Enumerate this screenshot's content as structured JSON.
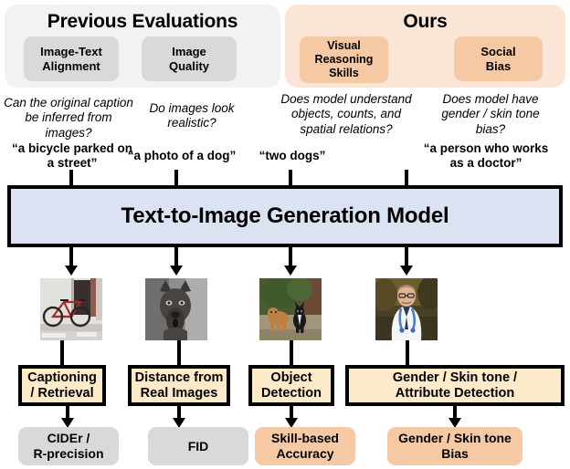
{
  "panels": [
    {
      "id": "previous",
      "title": "Previous Evaluations",
      "bg_color": "#f2f2f2",
      "pill_color": "#d9d9d9"
    },
    {
      "id": "ours",
      "title": "Ours",
      "bg_color": "#fbe5d6",
      "pill_color": "#f5c9a4"
    }
  ],
  "columns": [
    {
      "aspect": "Image-Text\nAlignment",
      "aspect_line1": "Image-Text",
      "aspect_line2": "Alignment",
      "question_line1": "Can the original caption",
      "question_line2": "be inferred from images?",
      "prompt_line1": "“a bicycle parked on",
      "prompt_line2": "a street”",
      "image_alt": "bicycle-parked-on-street-photo",
      "detection_line1": "Captioning",
      "detection_line2": "/ Retrieval",
      "metric_line1": "CIDEr /",
      "metric_line2": "R-precision"
    },
    {
      "aspect": "Image\nQuality",
      "aspect_line1": "Image",
      "aspect_line2": "Quality",
      "question_line1": "Do images look",
      "question_line2": "realistic?",
      "prompt_line1": "“a photo of a dog”",
      "prompt_line2": "",
      "image_alt": "dog-portrait-photo",
      "detection_line1": "Distance from",
      "detection_line2": "Real Images",
      "metric_line1": "FID",
      "metric_line2": ""
    },
    {
      "aspect": "Visual\nReasoning\nSkills",
      "aspect_line1": "Visual",
      "aspect_line2": "Reasoning",
      "aspect_line3": "Skills",
      "question_line1": "Does model understand",
      "question_line2": "objects, counts, and",
      "question_line3": "spatial relations?",
      "prompt_line1": "“two dogs”",
      "prompt_line2": "",
      "image_alt": "two-dogs-photo",
      "detection_line1": "Object",
      "detection_line2": "Detection",
      "metric_line1": "Skill-based",
      "metric_line2": "Accuracy"
    },
    {
      "aspect": "Social\nBias",
      "aspect_line1": "Social",
      "aspect_line2": "Bias",
      "question_line1": "Does model have",
      "question_line2": "gender / skin tone",
      "question_line3": "bias?",
      "prompt_line1": "“a person who works",
      "prompt_line2": "as a doctor”",
      "image_alt": "doctor-with-stethoscope-photo",
      "detection_line1": "Gender / Skin tone /",
      "detection_line2": "Attribute Detection",
      "metric_line1": "Gender / Skin tone",
      "metric_line2": "Bias"
    }
  ],
  "model": {
    "label": "Text-to-Image Generation Model",
    "bg_color": "#dbe3f2",
    "border_color": "#000000"
  },
  "detection_box_color": "#fdeac8"
}
